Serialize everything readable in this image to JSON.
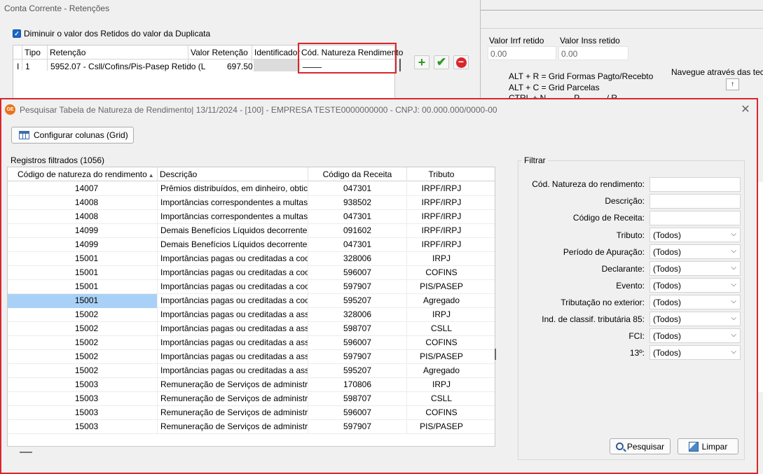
{
  "background": {
    "window_title": "Conta Corrente - Retenções",
    "checkbox_label": "Diminuir o valor dos Retidos do valor da Duplicata",
    "grid_headers": [
      "Tipo",
      "Retenção",
      "Valor Retenção",
      "Identificador",
      "Cód. Natureza Rendimento"
    ],
    "grid_row": {
      "marker": "I",
      "tipo": "1",
      "retencao": "5952.07 - Csll/Cofins/Pis-Pasep Retido (L",
      "valor": "697.50"
    },
    "irrf_label": "Valor Irrf retido",
    "irrf_value": "0.00",
    "inss_label": "Valor Inss retido",
    "inss_value": "0.00",
    "shortcut1": "ALT + R = Grid Formas Pagto/Recebto",
    "shortcut2": "ALT + C = Grid Parcelas",
    "shortcut3": "CTRL + N... ... ... P... ... ... / R... ... ... ...",
    "nav_label": "Navegue através das tecl",
    "nav_up": "↑"
  },
  "dialog": {
    "title": "Pesquisar Tabela de Natureza de Rendimento|  13/11/2024 - [100] - EMPRESA TESTE0000000000 - CNPJ: 00.000.000/0000-00",
    "app_icon_text": "GE",
    "close": "✕",
    "config_button": "Configurar colunas (Grid)",
    "records_label": "Registros filtrados (1056)",
    "columns": [
      "Código de natureza do rendimento",
      "Descrição",
      "Código da Receita",
      "Tributo"
    ],
    "rows": [
      [
        "14007",
        "Prêmios distribuídos, em dinheiro, obtic",
        "047301",
        "IRPF/IRPJ"
      ],
      [
        "14008",
        "Importâncias correspondentes a multas",
        "938502",
        "IRPF/IRPJ"
      ],
      [
        "14008",
        "Importâncias correspondentes a multas",
        "047301",
        "IRPF/IRPJ"
      ],
      [
        "14099",
        "Demais Benefícios Líquidos decorrentes",
        "091602",
        "IRPF/IRPJ"
      ],
      [
        "14099",
        "Demais Benefícios Líquidos decorrentes",
        "047301",
        "IRPF/IRPJ"
      ],
      [
        "15001",
        "Importâncias pagas ou creditadas a coo",
        "328006",
        "IRPJ"
      ],
      [
        "15001",
        "Importâncias pagas ou creditadas a coo",
        "596007",
        "COFINS"
      ],
      [
        "15001",
        "Importâncias pagas ou creditadas a coo",
        "597907",
        "PIS/PASEP"
      ],
      [
        "15001",
        "Importâncias pagas ou creditadas a coo",
        "595207",
        "Agregado"
      ],
      [
        "15002",
        "Importâncias pagas ou creditadas a assc",
        "328006",
        "IRPJ"
      ],
      [
        "15002",
        "Importâncias pagas ou creditadas a assc",
        "598707",
        "CSLL"
      ],
      [
        "15002",
        "Importâncias pagas ou creditadas a assc",
        "596007",
        "COFINS"
      ],
      [
        "15002",
        "Importâncias pagas ou creditadas a assc",
        "597907",
        "PIS/PASEP"
      ],
      [
        "15002",
        "Importâncias pagas ou creditadas a assc",
        "595207",
        "Agregado"
      ],
      [
        "15003",
        "Remuneração de Serviços de administra",
        "170806",
        "IRPJ"
      ],
      [
        "15003",
        "Remuneração de Serviços de administra",
        "598707",
        "CSLL"
      ],
      [
        "15003",
        "Remuneração de Serviços de administra",
        "596007",
        "COFINS"
      ],
      [
        "15003",
        "Remuneração de Serviços de administra",
        "597907",
        "PIS/PASEP"
      ]
    ],
    "filter": {
      "title": "Filtrar",
      "cod_natureza": "Cód. Natureza do rendimento:",
      "descricao": "Descrição:",
      "cod_receita": "Código de Receita:",
      "tributo": "Tributo:",
      "periodo": "Período de Apuração:",
      "declarante": "Declarante:",
      "evento": "Evento:",
      "tributacao": "Tributação no exterior:",
      "ind_classif": "Ind. de classif. tributária 85:",
      "fci": "FCI:",
      "decimo": "13º:",
      "todos": "(Todos)",
      "chevron": "⌵"
    },
    "buttons": {
      "pesquisar": "Pesquisar",
      "limpar": "Limpar"
    }
  }
}
